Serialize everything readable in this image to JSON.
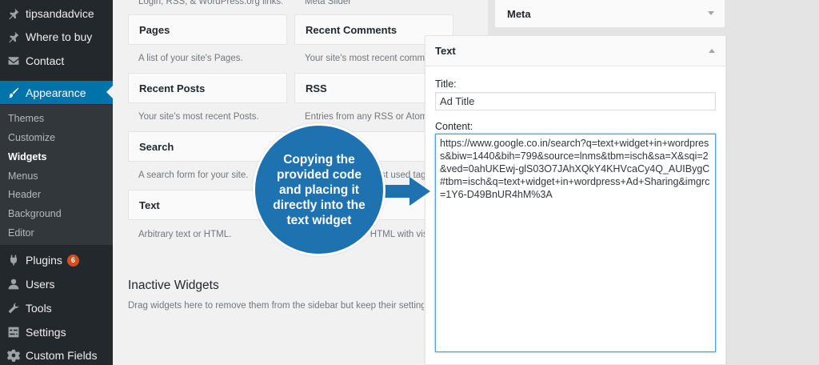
{
  "sidebar": {
    "items": [
      {
        "label": "tipsandadvice",
        "icon": "pushpin-icon"
      },
      {
        "label": "Where to buy",
        "icon": "pushpin-icon"
      },
      {
        "label": "Contact",
        "icon": "envelope-icon"
      },
      {
        "label": "Appearance",
        "icon": "paintbrush-icon",
        "current": true
      },
      {
        "label": "Plugins",
        "icon": "plug-icon",
        "badge": "6"
      },
      {
        "label": "Users",
        "icon": "user-icon"
      },
      {
        "label": "Tools",
        "icon": "wrench-icon"
      },
      {
        "label": "Settings",
        "icon": "settings-icon"
      },
      {
        "label": "Custom Fields",
        "icon": "gear-icon"
      }
    ],
    "submenu": [
      "Themes",
      "Customize",
      "Widgets",
      "Menus",
      "Header",
      "Background",
      "Editor"
    ],
    "active_submenu": "Widgets"
  },
  "widgets": {
    "top_left_desc": "Login, RSS, & WordPress.org links.",
    "top_right_desc": "Meta Slider",
    "items": [
      {
        "title": "Pages",
        "desc": "A list of your site's Pages."
      },
      {
        "title": "Recent Comments",
        "desc": "Your site's most recent comments."
      },
      {
        "title": "Recent Posts",
        "desc": "Your site's most recent Posts."
      },
      {
        "title": "RSS",
        "desc": "Entries from any RSS or Atom feed."
      },
      {
        "title": "Search",
        "desc": "A search form for your site."
      },
      {
        "title": "",
        "desc": "A cloud of your most used tags."
      },
      {
        "title": "Text",
        "desc": "Arbitrary text or HTML."
      },
      {
        "title": "",
        "desc": "Arbitrary text or HTML with visual editor."
      }
    ]
  },
  "inactive": {
    "title": "Inactive Widgets",
    "desc": "Drag widgets here to remove them from the sidebar but keep their settings."
  },
  "meta_widget": {
    "title": "Meta"
  },
  "text_widget": {
    "header": "Text",
    "title_label": "Title:",
    "title_value": "Ad Title",
    "content_label": "Content:",
    "content_value": "https://www.google.co.in/search?q=text+widget+in+wordpress&biw=1440&bih=799&source=lnms&tbm=isch&sa=X&sqi=2&ved=0ahUKEwj-glS03O7JAhXQkY4KHVcaCy4Q_AUIBygC#tbm=isch&q=text+widget+in+wordpress+Ad+Sharing&imgrc=1Y6-D49BnUR4hM%3A"
  },
  "callout": {
    "text": "Copying the provided code and placing it directly into the text widget"
  },
  "colors": {
    "accent": "#0073aa",
    "callout": "#1e72b0",
    "badge": "#d54e21"
  }
}
